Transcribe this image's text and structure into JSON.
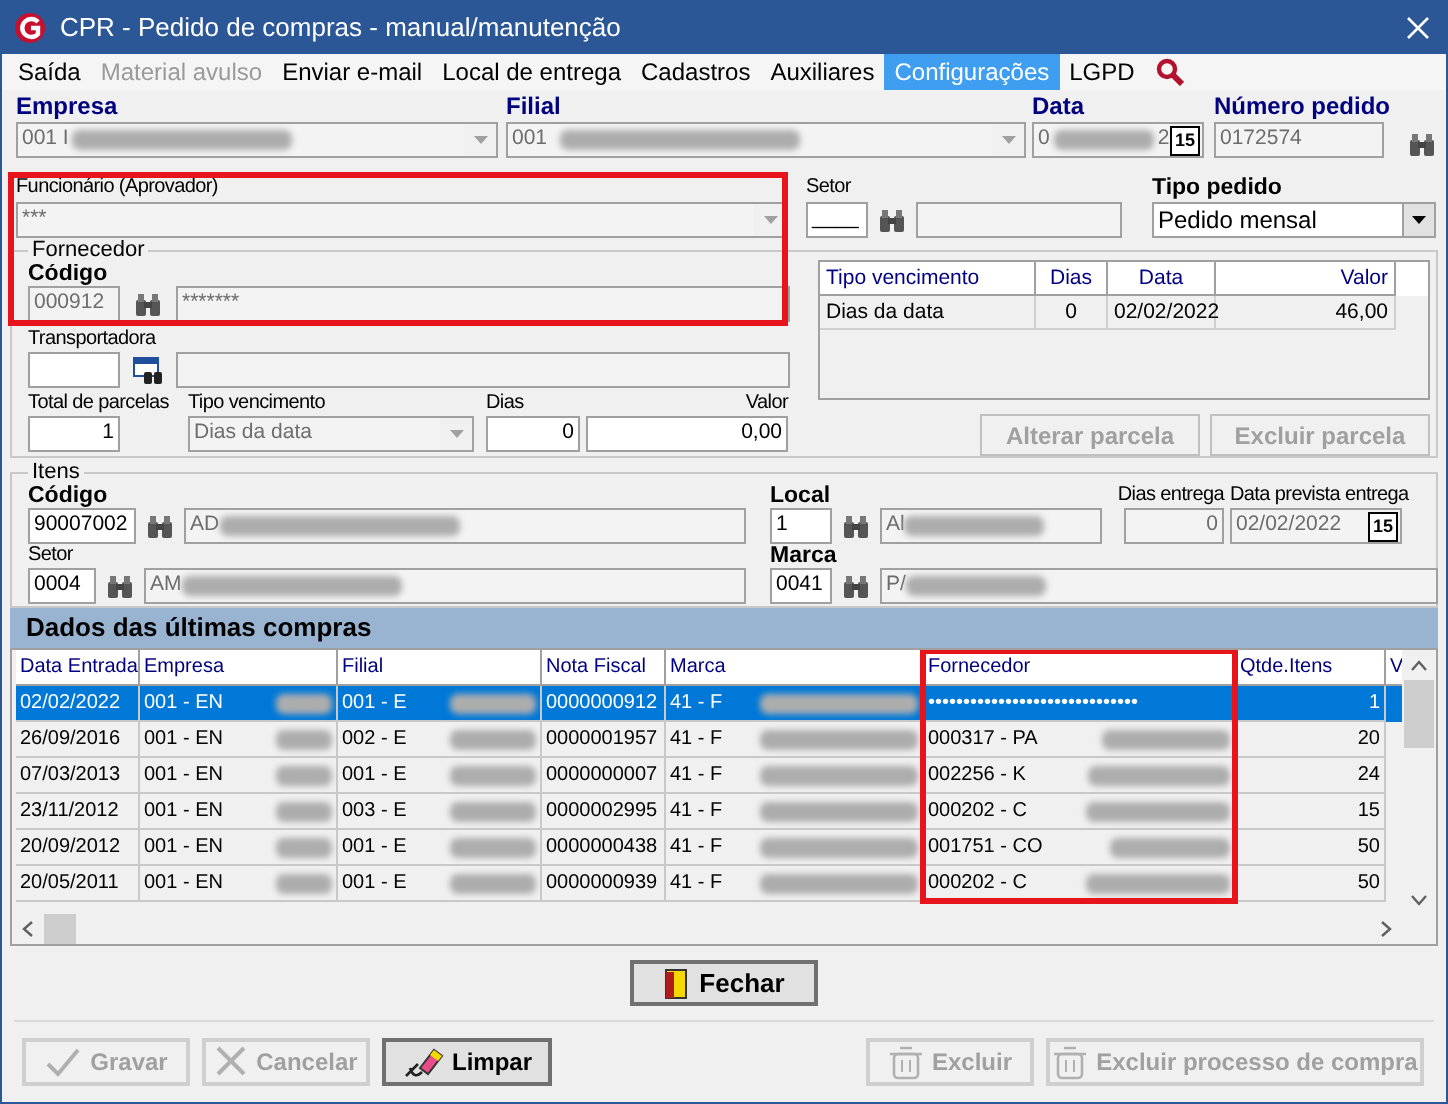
{
  "window": {
    "title": "CPR - Pedido de compras - manual/manutenção"
  },
  "menu": [
    {
      "label": "Saída",
      "selected": false,
      "disabled": false
    },
    {
      "label": "Material avulso",
      "selected": false,
      "disabled": true
    },
    {
      "label": "Enviar e-mail",
      "selected": false,
      "disabled": false
    },
    {
      "label": "Local de entrega",
      "selected": false,
      "disabled": false
    },
    {
      "label": "Cadastros",
      "selected": false,
      "disabled": false
    },
    {
      "label": "Auxiliares",
      "selected": false,
      "disabled": false
    },
    {
      "label": "Configurações",
      "selected": true,
      "disabled": false
    },
    {
      "label": "LGPD",
      "selected": false,
      "disabled": false
    }
  ],
  "header": {
    "empresa": {
      "label": "Empresa",
      "value": "001 I",
      "blurred": true,
      "disabled": true
    },
    "filial": {
      "label": "Filial",
      "value": "001",
      "blurred": true,
      "disabled": true
    },
    "data": {
      "label": "Data",
      "value": "0",
      "blurred": true,
      "value_end": "2",
      "disabled": true,
      "calendar": "15"
    },
    "numero_pedido": {
      "label": "Número pedido",
      "value": "0172574",
      "disabled": true
    }
  },
  "funcionario": {
    "label": "Funcionário (Aprovador)",
    "value": "***",
    "disabled": true,
    "highlighted": true
  },
  "setor": {
    "label": "Setor",
    "code": {
      "value": "____",
      "disabled": false
    },
    "name": {
      "disabled": true
    }
  },
  "tipo_pedido": {
    "label": "Tipo pedido",
    "value": "Pedido mensal"
  },
  "fornecedor": {
    "title": "Fornecedor",
    "codigo_label": "Código",
    "codigo": {
      "value": "000912",
      "disabled": true
    },
    "nome": {
      "value": "*******",
      "disabled": true
    },
    "transportadora_label": "Transportadora",
    "transportadora": {
      "disabled": false
    },
    "transportadora_nome": {
      "disabled": true
    },
    "total_parcelas": {
      "label": "Total de parcelas",
      "value": "1",
      "disabled": false
    },
    "tipo_vencimento": {
      "label": "Tipo vencimento",
      "value": "Dias da data",
      "disabled": true
    },
    "dias": {
      "label": "Dias",
      "value": "0",
      "disabled": false
    },
    "valor": {
      "label": "Valor",
      "value": "0,00",
      "disabled": false
    }
  },
  "parcelas": {
    "columns": [
      "Tipo vencimento",
      "Dias",
      "Data",
      "Valor"
    ],
    "rows": [
      [
        "Dias da data",
        "0",
        "02/02/2022",
        "46,00"
      ]
    ],
    "buttons": [
      {
        "label": "Alterar parcela",
        "disabled": true
      },
      {
        "label": "Excluir parcela",
        "disabled": true
      }
    ]
  },
  "itens": {
    "title": "Itens",
    "codigo_label": "Código",
    "codigo": {
      "value": "90007002",
      "disabled": false
    },
    "descricao": {
      "value": "AD",
      "blurred": true,
      "disabled": true
    },
    "local_label": "Local",
    "local": {
      "value": "1",
      "disabled": false
    },
    "local_nome": {
      "value": "Al",
      "blurred": true,
      "disabled": true
    },
    "dias_entrega": {
      "label": "Dias entrega",
      "value": "0",
      "disabled": true
    },
    "data_prevista": {
      "label": "Data prevista entrega",
      "value": "02/02/2022",
      "disabled": true,
      "calendar": "15"
    },
    "setor_label": "Setor",
    "setor": {
      "value": "0004",
      "disabled": false
    },
    "setor_nome": {
      "value": "AM",
      "blurred": true,
      "disabled": true
    },
    "marca_label": "Marca",
    "marca": {
      "value": "0041",
      "disabled": false
    },
    "marca_nome": {
      "value": "P/",
      "blurred": true,
      "disabled": true
    }
  },
  "ultimas_compras": {
    "title": "Dados das últimas compras",
    "columns": [
      {
        "label": "Data Entrada",
        "highlighted": false
      },
      {
        "label": "Empresa",
        "highlighted": false
      },
      {
        "label": "Filial",
        "highlighted": false
      },
      {
        "label": "Nota Fiscal",
        "highlighted": false
      },
      {
        "label": "Marca",
        "highlighted": false
      },
      {
        "label": "Fornecedor",
        "highlighted": true
      },
      {
        "label": "Qtde.Itens",
        "highlighted": false
      },
      {
        "label": "V",
        "highlighted": false
      }
    ],
    "rows": [
      {
        "selected": true,
        "cells": [
          {
            "text": "02/02/2022",
            "blurred": false
          },
          {
            "text": "001 - EN",
            "blurred": true
          },
          {
            "text": "001 - E",
            "blurred": true
          },
          {
            "text": "0000000912",
            "blurred": false
          },
          {
            "text": "41 - F",
            "blurred": true
          },
          {
            "text": "••••••••••••••••••••••••••••••",
            "blurred": false
          },
          {
            "text": "1",
            "blurred": false
          }
        ]
      },
      {
        "selected": false,
        "cells": [
          {
            "text": "26/09/2016",
            "blurred": false
          },
          {
            "text": "001 - EN",
            "blurred": true
          },
          {
            "text": "002 - E",
            "blurred": true
          },
          {
            "text": "0000001957",
            "blurred": false
          },
          {
            "text": "41 - F",
            "blurred": true
          },
          {
            "text": "000317 - PA",
            "blurred": true
          },
          {
            "text": "20",
            "blurred": false
          }
        ]
      },
      {
        "selected": false,
        "cells": [
          {
            "text": "07/03/2013",
            "blurred": false
          },
          {
            "text": "001 - EN",
            "blurred": true
          },
          {
            "text": "001 - E",
            "blurred": true
          },
          {
            "text": "0000000007",
            "blurred": false
          },
          {
            "text": "41 - F",
            "blurred": true
          },
          {
            "text": "002256 - K",
            "blurred": true
          },
          {
            "text": "24",
            "blurred": false
          }
        ]
      },
      {
        "selected": false,
        "cells": [
          {
            "text": "23/11/2012",
            "blurred": false
          },
          {
            "text": "001 - EN",
            "blurred": true
          },
          {
            "text": "003 - E",
            "blurred": true
          },
          {
            "text": "0000002995",
            "blurred": false
          },
          {
            "text": "41 - F",
            "blurred": true
          },
          {
            "text": "000202 - C",
            "blurred": true
          },
          {
            "text": "15",
            "blurred": false
          }
        ]
      },
      {
        "selected": false,
        "cells": [
          {
            "text": "20/09/2012",
            "blurred": false
          },
          {
            "text": "001 - EN",
            "blurred": true
          },
          {
            "text": "001 - E",
            "blurred": true
          },
          {
            "text": "0000000438",
            "blurred": false
          },
          {
            "text": "41 - F",
            "blurred": true
          },
          {
            "text": "001751 - CO",
            "blurred": true
          },
          {
            "text": "50",
            "blurred": false
          }
        ]
      },
      {
        "selected": false,
        "cells": [
          {
            "text": "20/05/2011",
            "blurred": false
          },
          {
            "text": "001 - EN",
            "blurred": true
          },
          {
            "text": "001 - E",
            "blurred": true
          },
          {
            "text": "0000000939",
            "blurred": false
          },
          {
            "text": "41 - F",
            "blurred": true
          },
          {
            "text": "000202 - C",
            "blurred": true
          },
          {
            "text": "50",
            "blurred": false
          }
        ]
      }
    ]
  },
  "close_button": {
    "label": "Fechar",
    "disabled": false
  },
  "actions": [
    {
      "label": "Gravar",
      "disabled": true,
      "kind": "check"
    },
    {
      "label": "Cancelar",
      "disabled": true,
      "kind": "cancel"
    },
    {
      "label": "Limpar",
      "disabled": false,
      "kind": "eraser"
    },
    {
      "label": "Excluir",
      "disabled": true,
      "kind": "trash"
    },
    {
      "label": "Excluir processo de compra",
      "disabled": true,
      "kind": "trash"
    }
  ]
}
